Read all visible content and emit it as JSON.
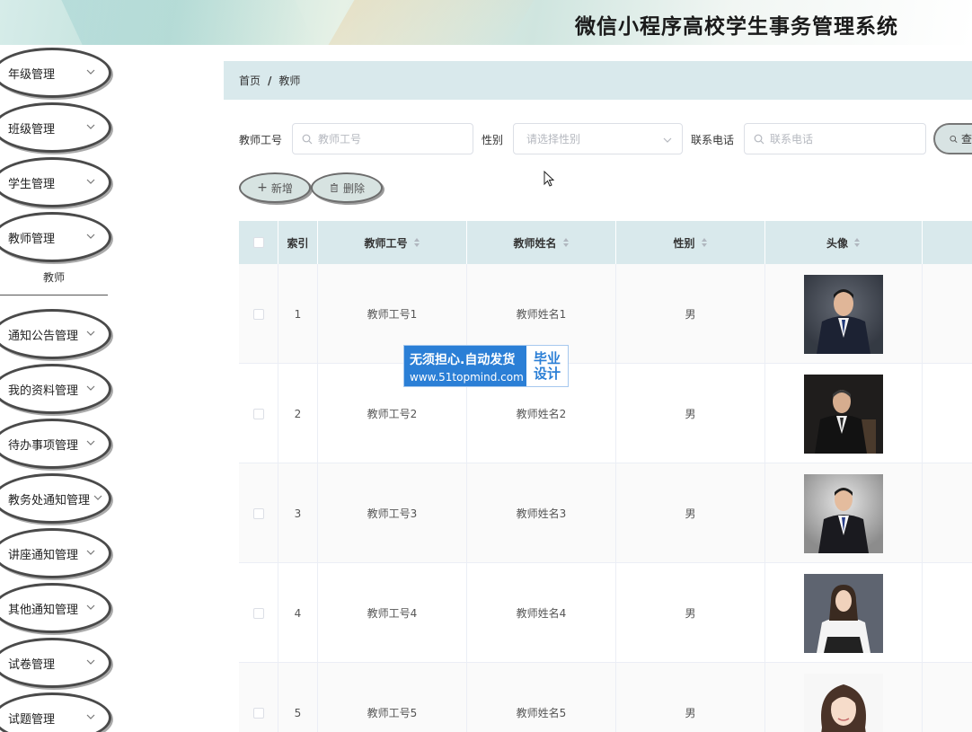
{
  "header": {
    "title": "微信小程序高校学生事务管理系统"
  },
  "sidebar": {
    "items": [
      {
        "label": "年级管理"
      },
      {
        "label": "班级管理"
      },
      {
        "label": "学生管理"
      },
      {
        "label": "教师管理"
      },
      {
        "label": "通知公告管理"
      },
      {
        "label": "我的资料管理"
      },
      {
        "label": "待办事项管理"
      },
      {
        "label": "教务处通知管理"
      },
      {
        "label": "讲座通知管理"
      },
      {
        "label": "其他通知管理"
      },
      {
        "label": "试卷管理"
      },
      {
        "label": "试题管理"
      }
    ],
    "sub_item": "教师"
  },
  "breadcrumb": {
    "home": "首页",
    "separator": "/",
    "current": "教师"
  },
  "search": {
    "teacher_no_label": "教师工号",
    "teacher_no_placeholder": "教师工号",
    "gender_label": "性别",
    "gender_placeholder": "请选择性别",
    "phone_label": "联系电话",
    "phone_placeholder": "联系电话",
    "query_label": "查"
  },
  "actions": {
    "add_label": "新增",
    "add_glyph": "+",
    "delete_label": "删除"
  },
  "table": {
    "columns": [
      "",
      "索引",
      "教师工号",
      "教师姓名",
      "性别",
      "头像"
    ],
    "rows": [
      {
        "index": "1",
        "teacher_no": "教师工号1",
        "teacher_name": "教师姓名1",
        "gender": "男",
        "avatar": "male-suit-portrait"
      },
      {
        "index": "2",
        "teacher_no": "教师工号2",
        "teacher_name": "教师姓名2",
        "gender": "男",
        "avatar": "male-suit-dark-portrait"
      },
      {
        "index": "3",
        "teacher_no": "教师工号3",
        "teacher_name": "教师姓名3",
        "gender": "男",
        "avatar": "male-suit-grey-portrait"
      },
      {
        "index": "4",
        "teacher_no": "教师工号4",
        "teacher_name": "教师姓名4",
        "gender": "男",
        "avatar": "female-white-shirt-portrait"
      },
      {
        "index": "5",
        "teacher_no": "教师工号5",
        "teacher_name": "教师姓名5",
        "gender": "男",
        "avatar": "female-white-background-portrait"
      }
    ]
  },
  "watermark": {
    "line1": "无须担心.自动发货",
    "line2": "www.51topmind.com",
    "tag1": "毕业",
    "tag2": "设计"
  },
  "colors": {
    "header_band": "#d9e9ec",
    "button_fill": "#d7e3e1",
    "watermark_blue": "#2b7fd6"
  }
}
